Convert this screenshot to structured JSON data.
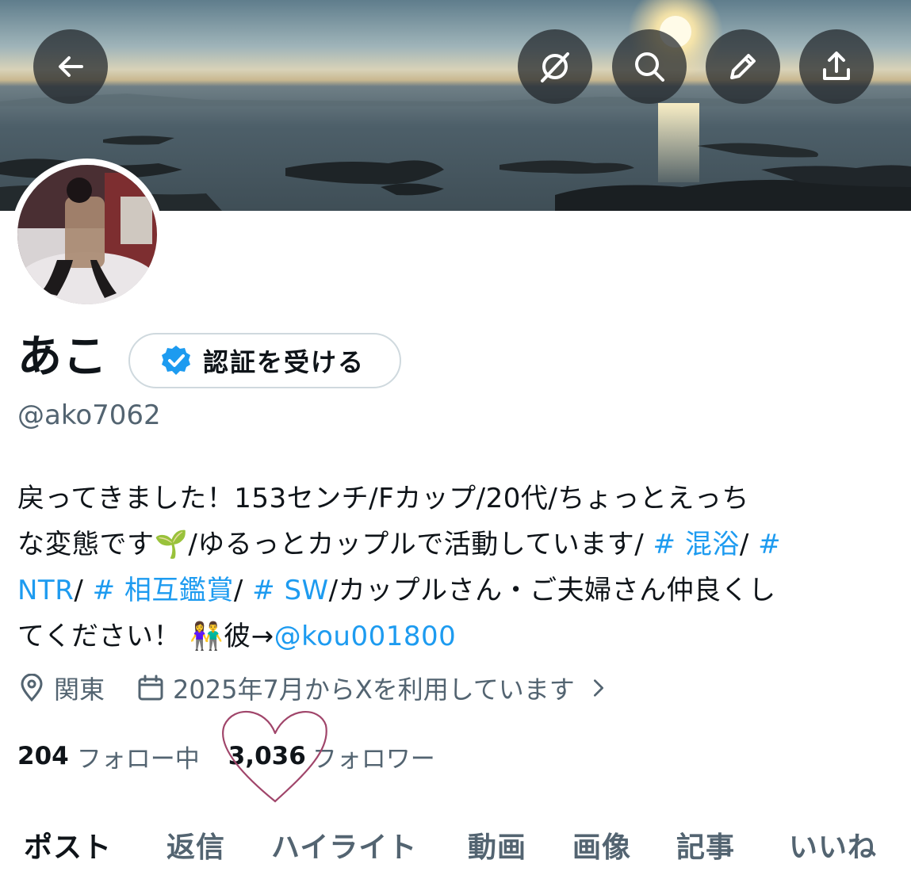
{
  "profile": {
    "name": "あこ",
    "handle": "@ako7062",
    "verify_button_label": "認証を受ける",
    "bio_lines": [
      [
        {
          "t": "戻ってきました！153センチ/Fカップ/20代/ちょっとえっち",
          "link": false
        }
      ],
      [
        {
          "t": "な変態です🌱/ゆるっとカップルで活動しています/ ",
          "link": false
        },
        {
          "t": "# 混浴",
          "link": true
        },
        {
          "t": "/ ",
          "link": false
        },
        {
          "t": "#",
          "link": true
        }
      ],
      [
        {
          "t": "NTR",
          "link": true
        },
        {
          "t": "/ ",
          "link": false
        },
        {
          "t": "# 相互鑑賞",
          "link": true
        },
        {
          "t": "/ ",
          "link": false
        },
        {
          "t": "# SW",
          "link": true
        },
        {
          "t": "/カップルさん・ご夫婦さん仲良くし",
          "link": false
        }
      ],
      [
        {
          "t": "てください！ 👫彼→",
          "link": false
        },
        {
          "t": "@kou001800",
          "link": true
        }
      ]
    ],
    "location": "関東",
    "joined": "2025年7月からXを利用しています",
    "following_count": "204",
    "following_label": "フォロー中",
    "followers_count": "3,036",
    "followers_label": "フォロワー"
  },
  "header_buttons": {
    "back": "arrow-left-icon",
    "grok": "grok-icon",
    "search": "search-icon",
    "edit": "pencil-icon",
    "share": "share-icon"
  },
  "tabs": [
    {
      "label": "ポスト",
      "active": true
    },
    {
      "label": "返信",
      "active": false
    },
    {
      "label": "ハイライト",
      "active": false
    },
    {
      "label": "動画",
      "active": false
    },
    {
      "label": "画像",
      "active": false
    },
    {
      "label": "記事",
      "active": false
    },
    {
      "label": "いいね",
      "active": false
    }
  ],
  "colors": {
    "link": "#1d9bf0",
    "text": "#0f1419",
    "muted": "#536471",
    "verified_badge": "#1d9bf0",
    "heart_annotation": "#a0456a"
  }
}
